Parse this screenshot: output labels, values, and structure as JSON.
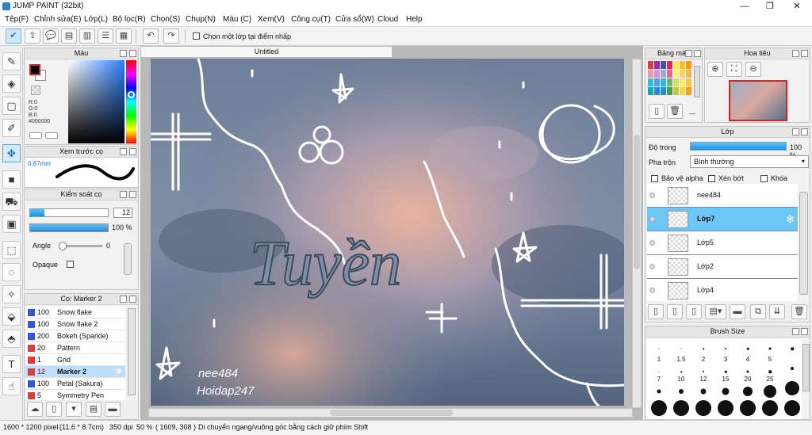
{
  "window": {
    "title": "JUMP PAINT (32bit)",
    "minimize": "—",
    "maximize": "❐",
    "close": "✕"
  },
  "menu": [
    "Tệp(F)",
    "Chỉnh sửa(E)",
    "Lớp(L)",
    "Bộ lọc(R)",
    "Chọn(S)",
    "Chụp(N)",
    "Màu (C)",
    "Xem(V)",
    "Công cụ(T)",
    "Cửa sổ(W)",
    "Cloud",
    "Help"
  ],
  "toolbar": {
    "sample_checkbox_label": "Chọn một lớp tại điểm nhấp"
  },
  "color_panel": {
    "title": "Màu",
    "r": "R:0",
    "g": "G:0",
    "b": "B:0",
    "hex": "#000000",
    "fg_color": "#000000",
    "bg_color": "#ffffff"
  },
  "brush_preview": {
    "title": "Xem trước cọ",
    "size_label": "0.87mm"
  },
  "brush_control": {
    "title": "Kiểm soát cọ",
    "size_value": "12",
    "opacity_value": "100 %",
    "opacity_fraction": 1.0,
    "size_fraction": 0.18,
    "angle_label": "Angle",
    "angle_value": "0",
    "opaque_label": "Opaque"
  },
  "brush_list": {
    "title": "Cọ: Marker 2",
    "items": [
      {
        "size": "100",
        "name": "Snow flake",
        "color": "#3457d9"
      },
      {
        "size": "100",
        "name": "Snow flake 2",
        "color": "#3457d9"
      },
      {
        "size": "200",
        "name": "Bokeh (Sparkle)",
        "color": "#3457d9"
      },
      {
        "size": "20",
        "name": "Pattern",
        "color": "#e53935"
      },
      {
        "size": "1",
        "name": "Grid",
        "color": "#e53935"
      },
      {
        "size": "12",
        "name": "Marker 2",
        "color": "#e53935",
        "selected": true
      },
      {
        "size": "100",
        "name": "Petal (Sakura)",
        "color": "#3457d9"
      },
      {
        "size": "5",
        "name": "Symmetry Pen",
        "color": "#e53935"
      }
    ]
  },
  "document": {
    "tab": "Untitled",
    "watermark_1": "nee484",
    "watermark_2": "Hoidap247",
    "lettering": "Tuyền"
  },
  "palette_panel": {
    "title": "Bảng màu",
    "colors": [
      "#e53935",
      "#9c27b0",
      "#3f51b5",
      "#e91e63",
      "#ffeb3b",
      "#ffc107",
      "#ff9800",
      "#f48fb1",
      "#ce93d8",
      "#9fa8da",
      "#f06292",
      "#fff176",
      "#ffd54f",
      "#ffb74d",
      "#26c6da",
      "#42a5f5",
      "#29b6f6",
      "#66bb6a",
      "#d4e157",
      "#ffee58",
      "#ffca28",
      "#00acc1",
      "#1e88e5",
      "#039be5",
      "#43a047",
      "#c0ca33",
      "#fdd835",
      "#ffa000"
    ],
    "trash_label": "---"
  },
  "navigator": {
    "title": "Hoa tiêu"
  },
  "layers_panel": {
    "title": "Lớp",
    "opacity_label": "Độ trong",
    "opacity_value": "100 %",
    "opacity_fraction": 1.0,
    "blend_label": "Pha trộn",
    "blend_value": "Bình thường",
    "protect_alpha": "Bảo vệ alpha",
    "clipping": "Xén bớt",
    "lock": "Khóa",
    "layers": [
      {
        "name": "nee484",
        "selected": false
      },
      {
        "name": "Lớp7",
        "selected": true
      },
      {
        "name": "Lớp5",
        "selected": false
      },
      {
        "name": "Lớp2",
        "selected": false
      },
      {
        "name": "Lớp4",
        "selected": false
      }
    ]
  },
  "brush_size_panel": {
    "title": "Brush Size",
    "sizes": [
      {
        "label": "",
        "d": 1
      },
      {
        "label": "",
        "d": 1
      },
      {
        "label": "",
        "d": 1.5
      },
      {
        "label": "",
        "d": 2
      },
      {
        "label": "",
        "d": 2.5
      },
      {
        "label": "",
        "d": 3
      },
      {
        "label": "",
        "d": 3.5
      },
      {
        "label": "1",
        "d": 1
      },
      {
        "label": "1.5",
        "d": 1.5
      },
      {
        "label": "2",
        "d": 2
      },
      {
        "label": "3",
        "d": 2.5
      },
      {
        "label": "4",
        "d": 3
      },
      {
        "label": "5",
        "d": 3.5
      },
      {
        "label": "",
        "d": 4
      },
      {
        "label": "7",
        "d": 5
      },
      {
        "label": "10",
        "d": 6
      },
      {
        "label": "12",
        "d": 7
      },
      {
        "label": "15",
        "d": 9
      },
      {
        "label": "20",
        "d": 12
      },
      {
        "label": "25",
        "d": 16
      },
      {
        "label": "",
        "d": 18
      },
      {
        "label": "",
        "d": 20
      },
      {
        "label": "",
        "d": 20
      },
      {
        "label": "",
        "d": 20
      },
      {
        "label": "",
        "d": 20
      },
      {
        "label": "",
        "d": 20
      },
      {
        "label": "",
        "d": 20
      },
      {
        "label": "",
        "d": 20
      }
    ]
  },
  "status": {
    "size": "1600 * 1200 pixel",
    "cm": "(11.6 * 8.7cm)",
    "dpi": "350 dpi",
    "zoom": "50 %",
    "coords": "( 1609, 308 )",
    "hint": "Di chuyển ngang/vuông góc bằng cách giữ phím Shift"
  }
}
